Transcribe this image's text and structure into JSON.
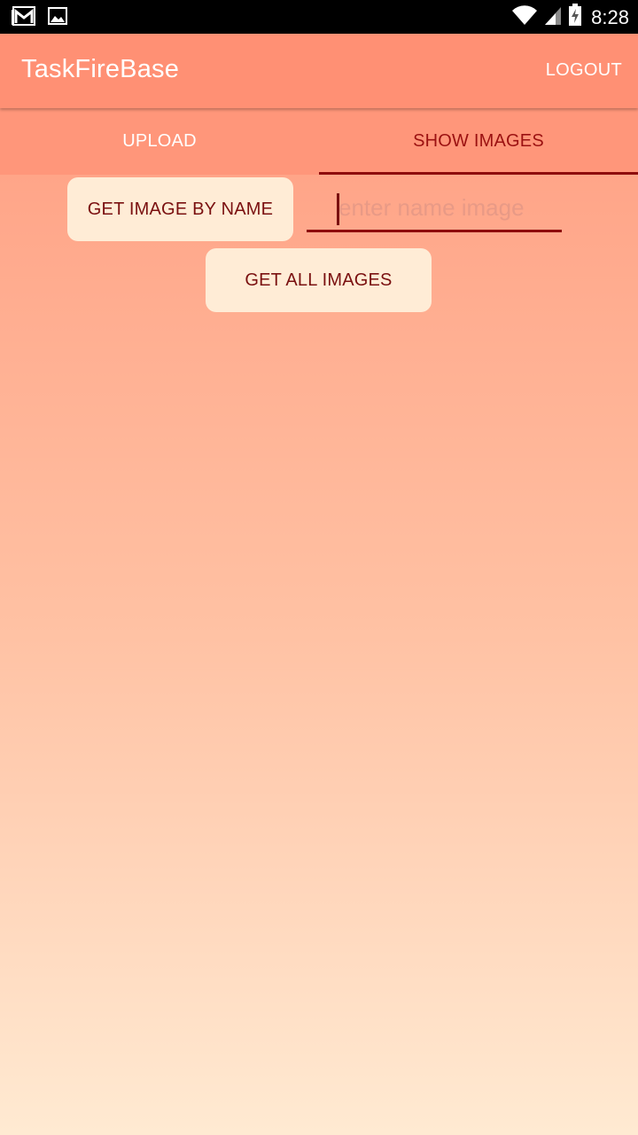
{
  "status_bar": {
    "time": "8:28",
    "icons": [
      "gmail-icon",
      "image-icon",
      "wifi-icon",
      "signal-icon",
      "battery-charging-icon"
    ]
  },
  "app_bar": {
    "title": "TaskFireBase",
    "logout_label": "LOGOUT"
  },
  "tabs": [
    {
      "label": "UPLOAD",
      "selected": false
    },
    {
      "label": "SHOW IMAGES",
      "selected": true
    }
  ],
  "main": {
    "get_by_name_label": "GET IMAGE BY NAME",
    "name_input": {
      "value": "",
      "placeholder": "enter name image"
    },
    "get_all_label": "GET ALL IMAGES"
  },
  "colors": {
    "app_bar": "#ff9074",
    "accent": "#8e0c0c",
    "button_bg": "#ffecd6",
    "gradient_top": "#ff9a7e",
    "gradient_bottom": "#ffead2"
  }
}
